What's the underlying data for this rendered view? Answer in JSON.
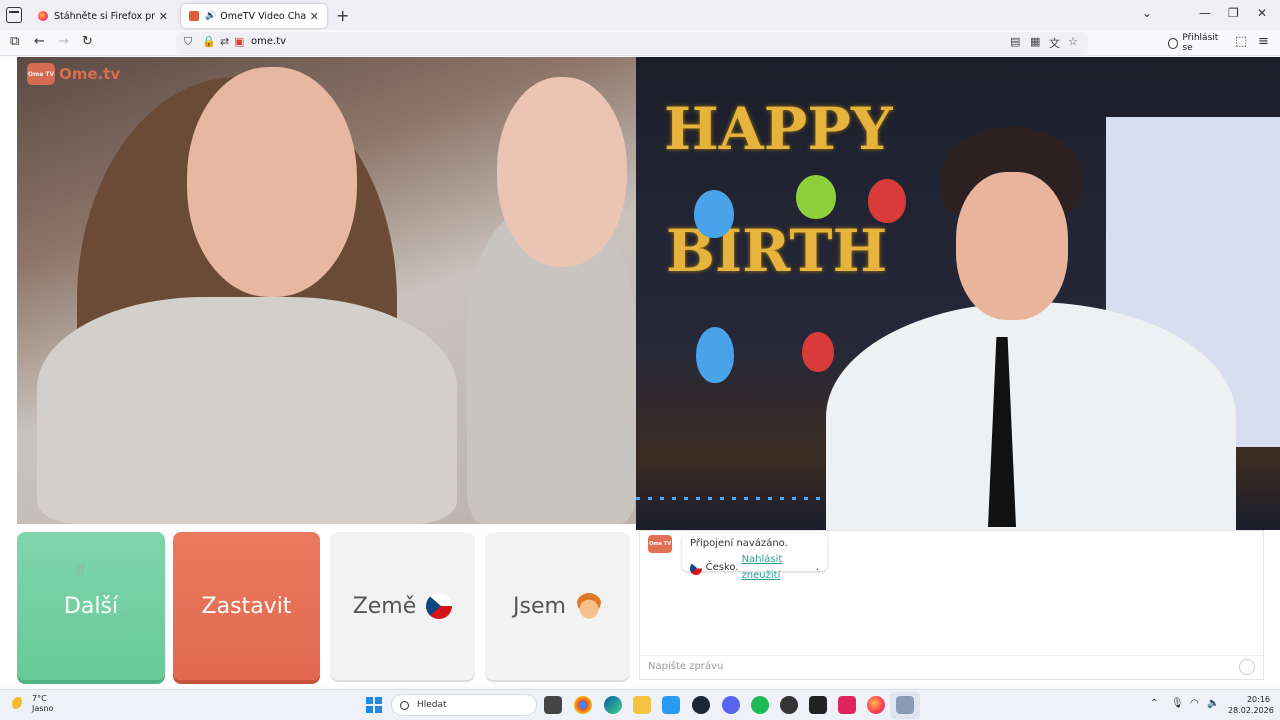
{
  "browser": {
    "tabs": [
      {
        "title": "Stáhněte si Firefox pro Android",
        "active": false
      },
      {
        "title": "OmeTV Video Chat — Ome",
        "active": true,
        "playing_audio": true
      }
    ],
    "url": "ome.tv",
    "signin_label": "Přihlásit se"
  },
  "site": {
    "logo_word": "Ome.tv",
    "logo_badge": "Ome TV"
  },
  "controls": {
    "next_label": "Další",
    "stop_label": "Zastavit",
    "country_label": "Země",
    "gender_label": "Jsem"
  },
  "chat": {
    "status": "Připojení navázáno.",
    "country": "Česko.",
    "report_link": "Nahlásit zneužití",
    "input_placeholder": "Napište zprávu"
  },
  "taskbar": {
    "weather_temp": "7°C",
    "weather_desc": "Jasno",
    "search_label": "Hledat",
    "time": "20:16",
    "date": "28.02.2026"
  },
  "colors": {
    "next": "#6fce9f",
    "stop": "#e66f53",
    "brand": "#e46f50"
  }
}
